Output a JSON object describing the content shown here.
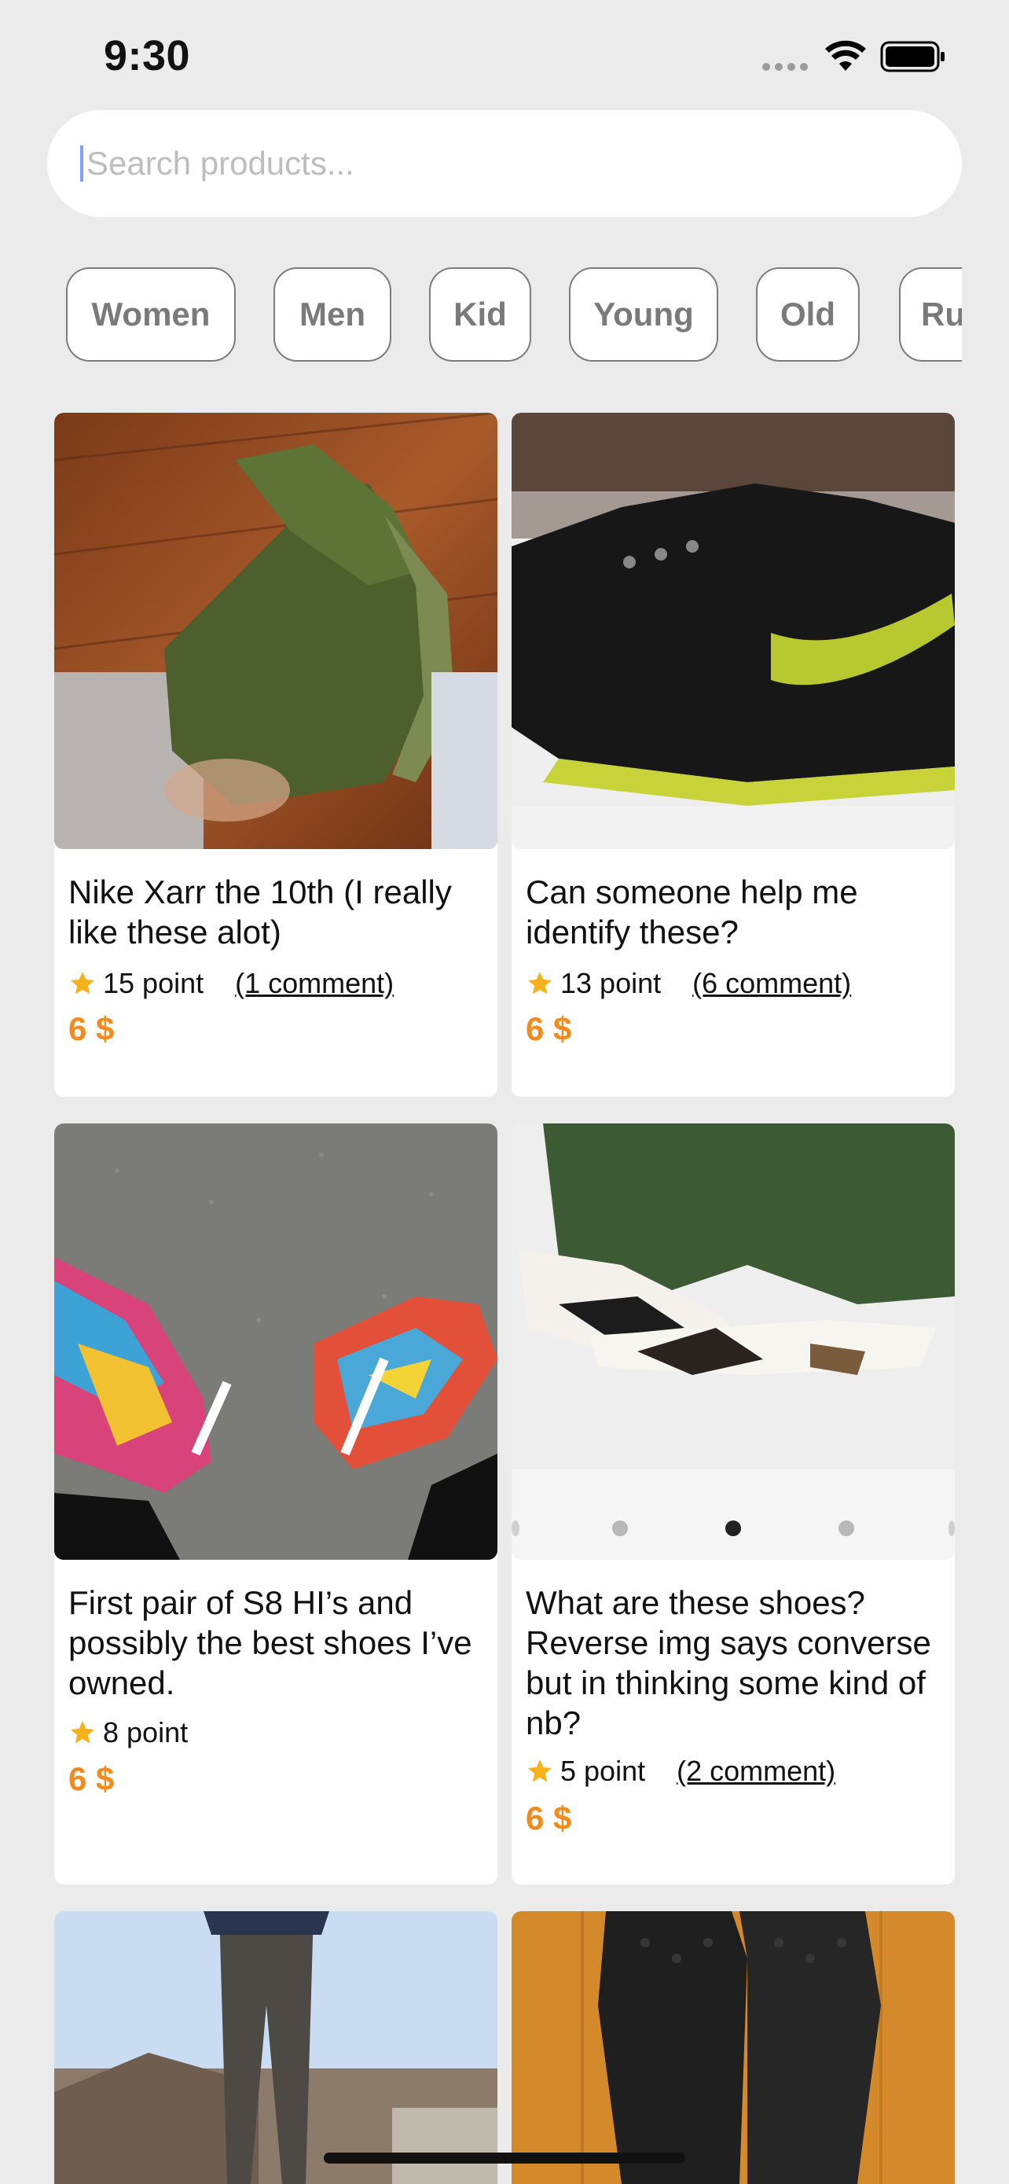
{
  "status_bar": {
    "time": "9:30"
  },
  "search": {
    "placeholder": "Search products..."
  },
  "categories": [
    "Women",
    "Men",
    "Kid",
    "Young",
    "Old",
    "Ru"
  ],
  "products": [
    {
      "title": "Nike Xarr the 10th (I really like these alot)",
      "points": "15 point",
      "comment": "(1 comment)",
      "price": "6 $"
    },
    {
      "title": "Can someone help me identify these?",
      "points": "13 point",
      "comment": "(6 comment)",
      "price": "6 $"
    },
    {
      "title": "First pair of S8 HI’s and possibly the best shoes I’ve owned.",
      "points": "8 point",
      "comment": "",
      "price": "6 $"
    },
    {
      "title": "What are these shoes? Reverse img says converse but in thinking some kind of nb?",
      "points": "5 point",
      "comment": "(2 comment)",
      "price": "6 $"
    }
  ],
  "colors": {
    "accent_price": "#f28a1c",
    "star": "#f7b21b",
    "background": "#ebebeb"
  }
}
